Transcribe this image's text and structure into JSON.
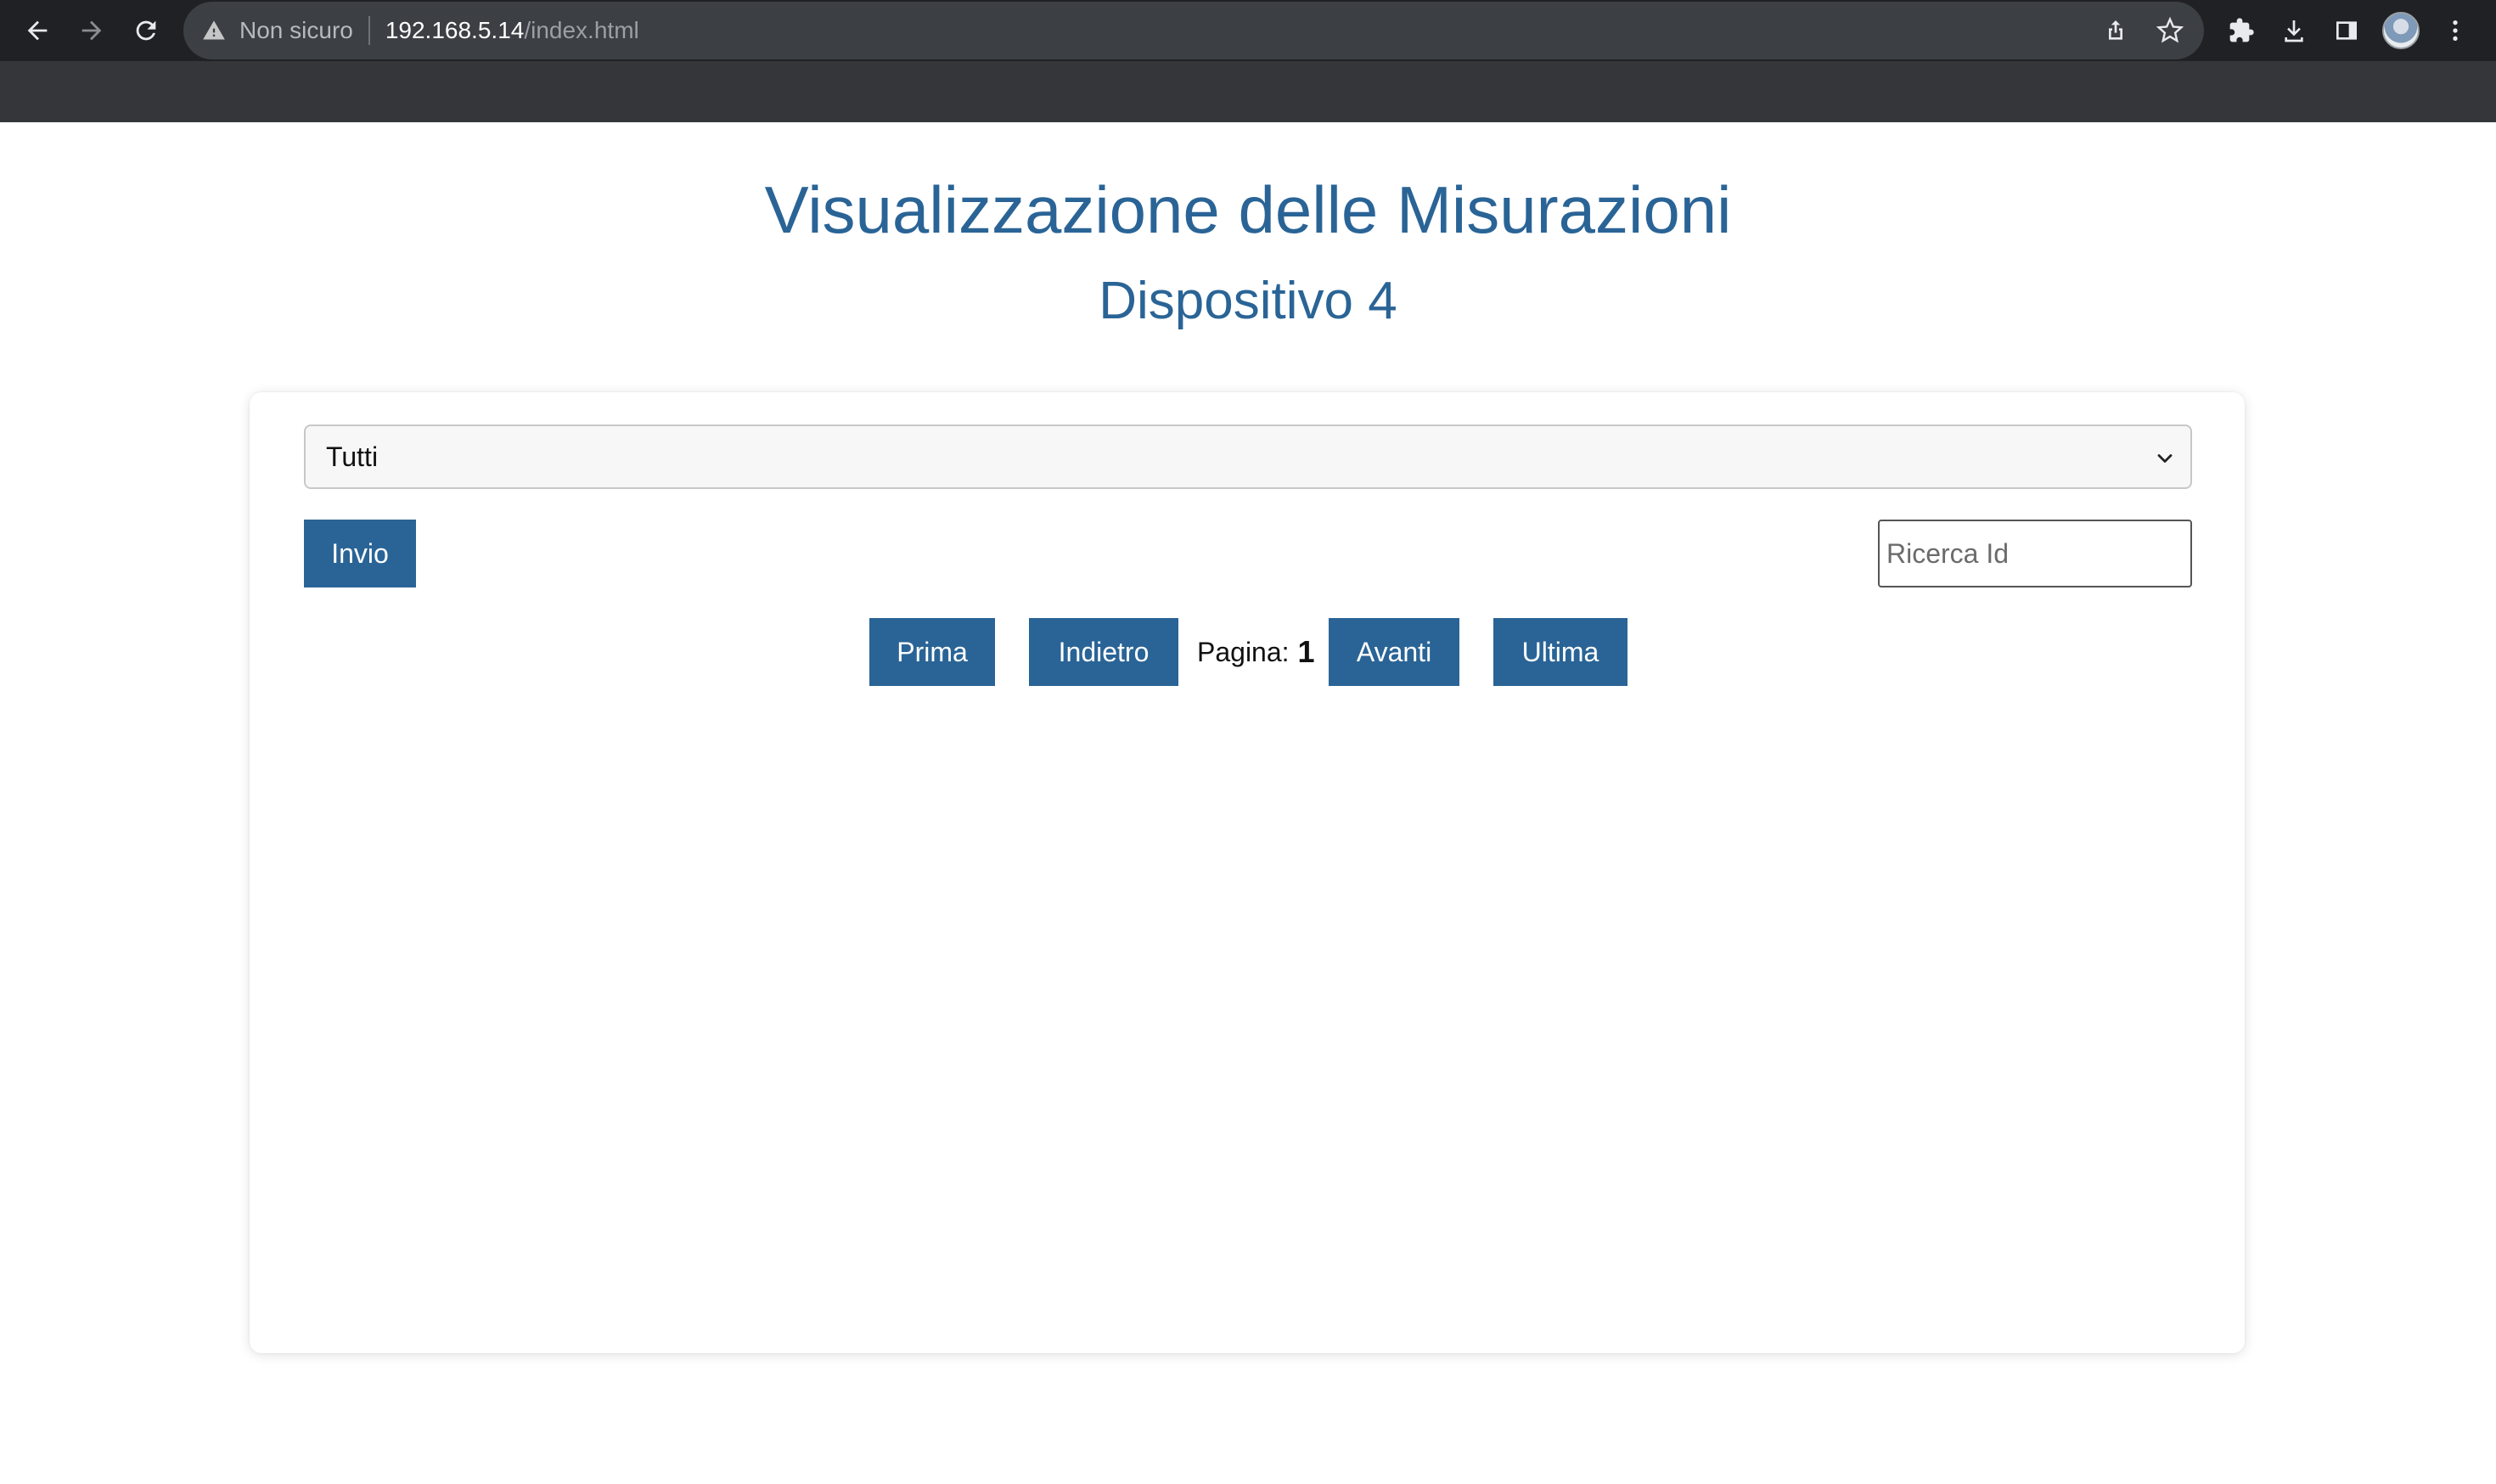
{
  "browser": {
    "security_label": "Non sicuro",
    "url_host": "192.168.5.14",
    "url_path": "/index.html"
  },
  "page": {
    "title": "Visualizzazione delle Misurazioni",
    "subtitle": "Dispositivo 4"
  },
  "filter": {
    "selected": "Tutti"
  },
  "actions": {
    "submit_label": "Invio",
    "search_placeholder": "Ricerca Id"
  },
  "pagination": {
    "first_label": "Prima",
    "prev_label": "Indietro",
    "page_label": "Pagina:",
    "page_number": "1",
    "next_label": "Avanti",
    "last_label": "Ultima"
  },
  "colors": {
    "accent": "#2a6496",
    "chrome_dark": "#202124",
    "chrome_tabbar": "#35363a"
  }
}
